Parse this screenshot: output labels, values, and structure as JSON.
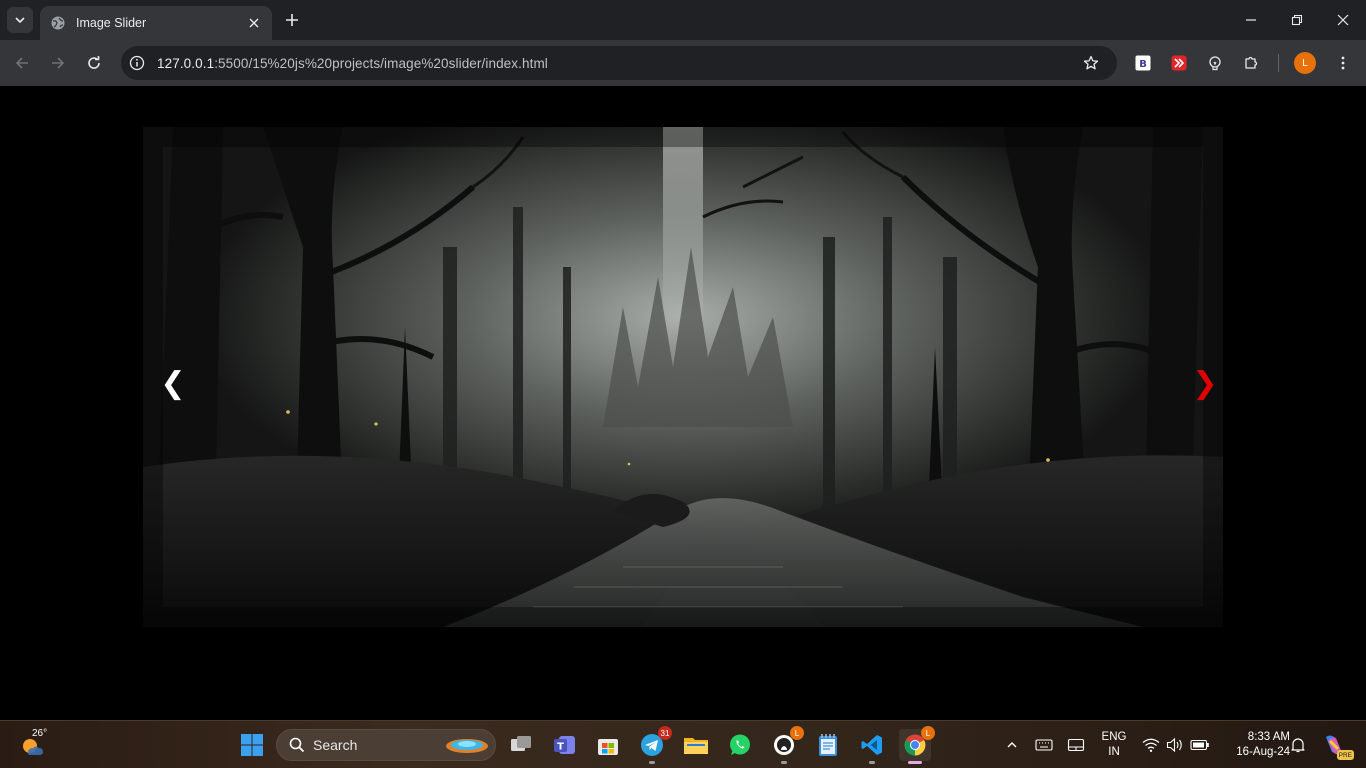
{
  "browser": {
    "tab_title": "Image Slider",
    "url_host": "127.0.0.1",
    "url_path": ":5500/15%20js%20projects/image%20slider/index.html",
    "profile_initial": "L",
    "extensions": [
      "b-extension-icon",
      "red-extension-icon",
      "bulb-extension-icon",
      "puzzle-extensions-icon"
    ]
  },
  "page": {
    "prev_arrow": "❮",
    "next_arrow": "❯",
    "slide_alt": "Dark misty forest with river",
    "colors": {
      "prev_arrow": "#ffffff",
      "next_arrow": "#e00000"
    }
  },
  "taskbar": {
    "weather_temp": "26°",
    "search_placeholder": "Search",
    "telegram_badge": "31",
    "github_badge": "L",
    "chrome_badge": "L",
    "language_top": "ENG",
    "language_bottom": "IN",
    "time": "8:33 AM",
    "date": "16-Aug-24",
    "copilot_badge": "PRE"
  }
}
